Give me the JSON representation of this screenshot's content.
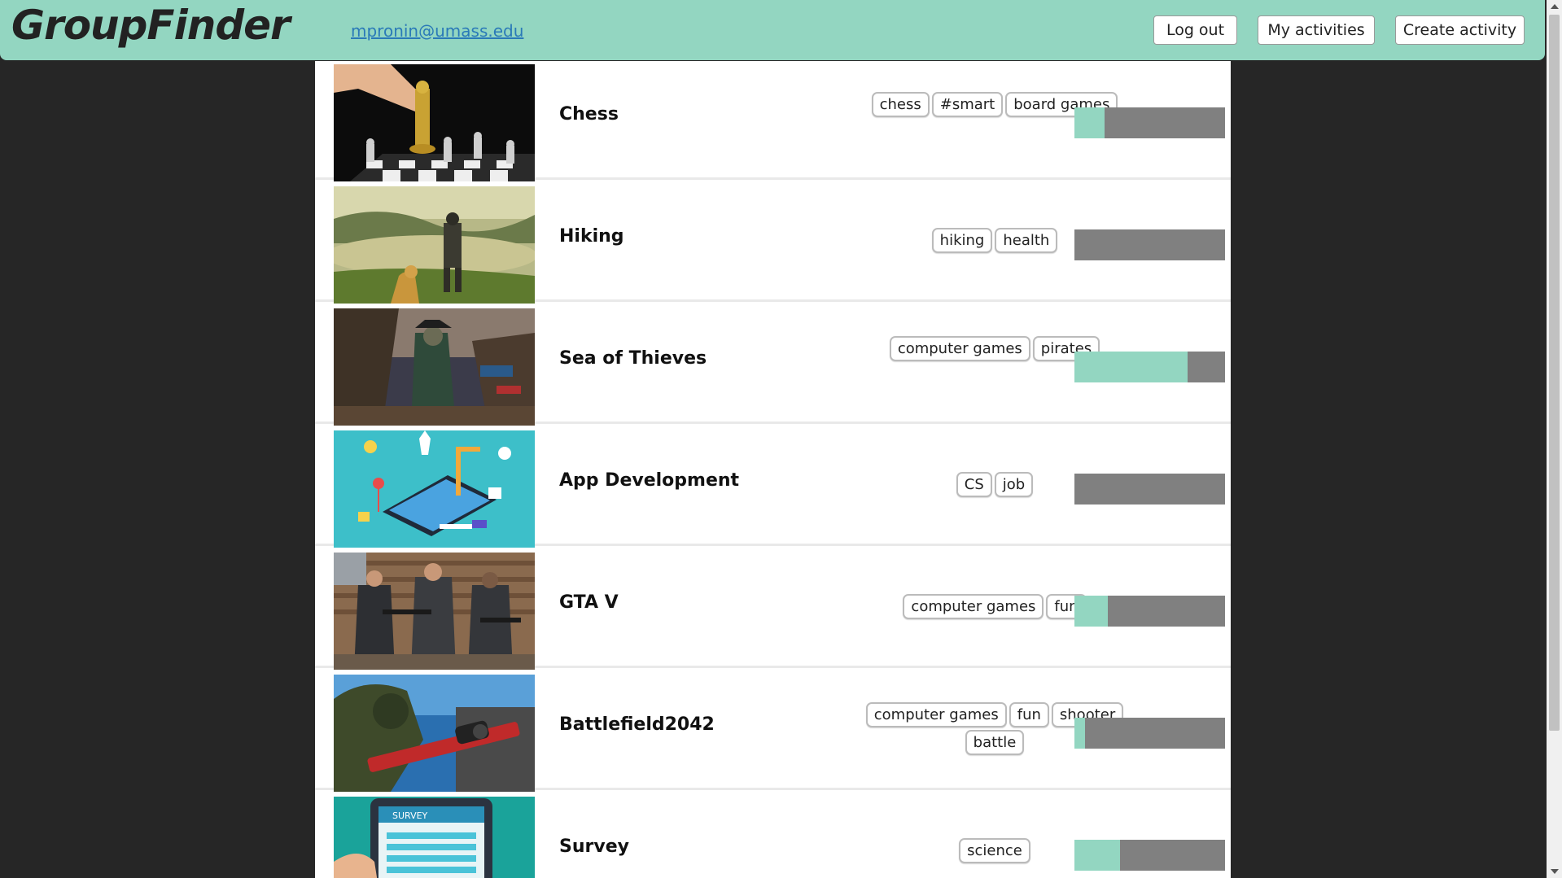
{
  "header": {
    "logo": "GroupFinder",
    "email": "mpronin@umass.edu",
    "logout_label": "Log out",
    "my_activities_label": "My activities",
    "create_activity_label": "Create activity"
  },
  "colors": {
    "accent": "#93d6c1",
    "background": "#262626",
    "bar_track": "#808080"
  },
  "activities": [
    {
      "name": "Chess",
      "image": "chess-photo",
      "tags": [
        "chess",
        "#smart",
        "board games"
      ],
      "progress": 0.2
    },
    {
      "name": "Hiking",
      "image": "hiking-photo",
      "tags": [
        "hiking",
        "health"
      ],
      "progress": 0.0
    },
    {
      "name": "Sea of Thieves",
      "image": "sea-of-thieves-photo",
      "tags": [
        "computer games",
        "pirates"
      ],
      "progress": 0.75
    },
    {
      "name": "App Development",
      "image": "app-development-illustration",
      "tags": [
        "CS",
        "job"
      ],
      "progress": 0.0
    },
    {
      "name": "GTA V",
      "image": "gta-v-photo",
      "tags": [
        "computer games",
        "fun"
      ],
      "progress": 0.22
    },
    {
      "name": "Battlefield2042",
      "image": "battlefield-photo",
      "tags": [
        "computer games",
        "fun",
        "shooter",
        "battle"
      ],
      "progress": 0.07
    },
    {
      "name": "Survey",
      "image": "survey-illustration",
      "tags": [
        "science"
      ],
      "progress": 0.3
    }
  ]
}
